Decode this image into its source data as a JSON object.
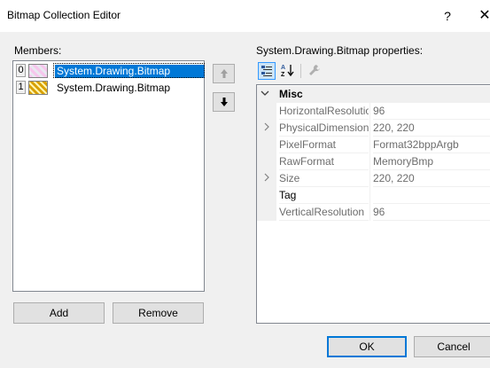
{
  "window": {
    "title": "Bitmap Collection Editor",
    "help_glyph": "?",
    "close_glyph": "✕"
  },
  "members": {
    "label": "Members:",
    "items": [
      {
        "index": "0",
        "name": "System.Drawing.Bitmap",
        "selected": true
      },
      {
        "index": "1",
        "name": "System.Drawing.Bitmap",
        "selected": false
      }
    ],
    "move_up_glyph": "🡑",
    "move_down_glyph": "🡓",
    "add_label": "Add",
    "remove_label": "Remove"
  },
  "properties": {
    "label": "System.Drawing.Bitmap properties:",
    "toolbar": {
      "categorized_icon": "categorized-icon",
      "alphabetical_icon": "alphabetical-icon",
      "property_pages_icon": "wrench-icon"
    },
    "category": {
      "name": "Misc",
      "expanded_glyph": "⌵"
    },
    "rows": [
      {
        "name": "HorizontalResolution",
        "value": "96",
        "expandable": false
      },
      {
        "name": "PhysicalDimension",
        "value": "220, 220",
        "expandable": true
      },
      {
        "name": "PixelFormat",
        "value": "Format32bppArgb",
        "expandable": false
      },
      {
        "name": "RawFormat",
        "value": "MemoryBmp",
        "expandable": false
      },
      {
        "name": "Size",
        "value": "220, 220",
        "expandable": true
      },
      {
        "name": "Tag",
        "value": "",
        "expandable": false,
        "editable": true
      },
      {
        "name": "VerticalResolution",
        "value": "96",
        "expandable": false
      }
    ],
    "expand_glyph": "›"
  },
  "footer": {
    "ok_label": "OK",
    "cancel_label": "Cancel"
  },
  "colors": {
    "selection": "#0078d7",
    "dialog_bg": "#f0f0f0"
  }
}
